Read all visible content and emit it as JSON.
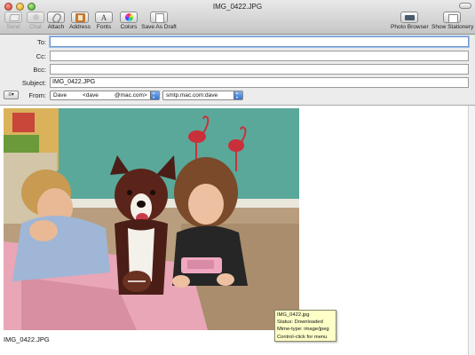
{
  "window": {
    "title": "IMG_0422.JPG"
  },
  "toolbar": {
    "buttons": [
      {
        "label": "Send",
        "icon": "send-icon",
        "enabled": false
      },
      {
        "label": "Chat",
        "icon": "chat-icon",
        "enabled": false
      },
      {
        "label": "Attach",
        "icon": "paperclip-icon",
        "enabled": true
      },
      {
        "label": "Address",
        "icon": "address-book-icon",
        "enabled": true
      },
      {
        "label": "Fonts",
        "icon": "fonts-icon",
        "enabled": true
      },
      {
        "label": "Colors",
        "icon": "color-wheel-icon",
        "enabled": true
      },
      {
        "label": "Save As Draft",
        "icon": "draft-icon",
        "enabled": true
      },
      {
        "label": "Photo Browser",
        "icon": "photo-browser-icon",
        "enabled": true
      },
      {
        "label": "Show Stationery",
        "icon": "stationery-icon",
        "enabled": true
      }
    ]
  },
  "header": {
    "to": {
      "label": "To:",
      "value": ""
    },
    "cc": {
      "label": "Cc:",
      "value": ""
    },
    "bcc": {
      "label": "Bcc:",
      "value": ""
    },
    "subject": {
      "label": "Subject:",
      "value": "IMG_0422.JPG"
    },
    "from": {
      "label": "From:",
      "account_name": "Dave",
      "account_email": "<dave          @mac.com>",
      "smtp_server": "smtp.mac.com:dave"
    }
  },
  "body": {
    "attachment": {
      "filename": "IMG_0422.JPG",
      "tooltip": {
        "line1": "IMG_0422.jpg",
        "line2": "Status: Downloaded",
        "line3": "Mime-type: image/jpeg",
        "line4": "Control-click for menu"
      }
    }
  },
  "colors": {
    "focus_ring": "#6f97cf",
    "popup_arrow": "#3874cf",
    "tooltip_bg": "#ffffc8"
  }
}
